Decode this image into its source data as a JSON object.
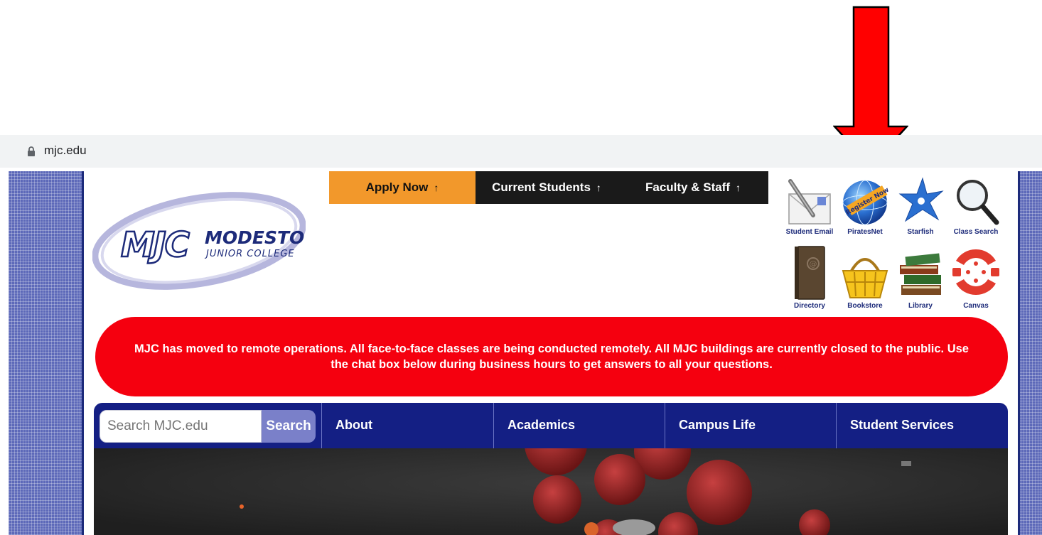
{
  "browser": {
    "url": "mjc.edu"
  },
  "top_tabs": [
    {
      "label": "Apply Now",
      "arrow": "↑"
    },
    {
      "label": "Current Students",
      "arrow": "↑"
    },
    {
      "label": "Faculty & Staff",
      "arrow": "↑"
    }
  ],
  "logo": {
    "line1": "MODESTO",
    "line2": "JUNIOR COLLEGE",
    "mark": "MJC"
  },
  "quick_links": [
    {
      "label": "Student Email",
      "icon": "envelope-pen-icon"
    },
    {
      "label": "PiratesNet",
      "icon": "register-now-globe-icon",
      "badge": "Register Now"
    },
    {
      "label": "Starfish",
      "icon": "starfish-icon"
    },
    {
      "label": "Class Search",
      "icon": "magnifier-icon"
    },
    {
      "label": "Directory",
      "icon": "address-book-icon"
    },
    {
      "label": "Bookstore",
      "icon": "shopping-basket-icon"
    },
    {
      "label": "Library",
      "icon": "books-icon"
    },
    {
      "label": "Canvas",
      "icon": "canvas-logo-icon"
    }
  ],
  "alert": {
    "text": "MJC has moved to remote operations. All face-to-face classes are being conducted remotely. All MJC buildings are currently closed to the public. Use the chat box below during business hours to get answers to all your questions.",
    "color": "#f5000f"
  },
  "nav": {
    "search_placeholder": "Search MJC.edu",
    "search_button": "Search",
    "items": [
      "About",
      "Academics",
      "Campus Life",
      "Student Services"
    ]
  },
  "colors": {
    "nav_blue": "#141f84",
    "apply_orange": "#f2982b",
    "annotation_arrow": "#ff0000"
  }
}
